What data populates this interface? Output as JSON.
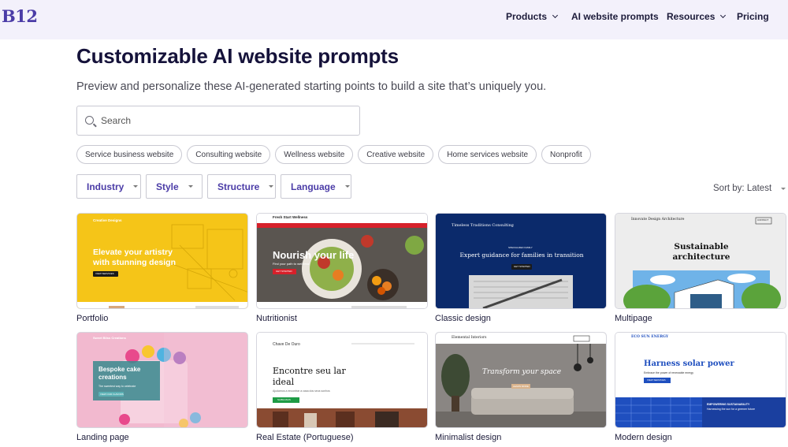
{
  "logo": "B12",
  "nav": {
    "products": "Products",
    "ai_prompts": "AI website prompts",
    "resources": "Resources",
    "pricing": "Pricing"
  },
  "page": {
    "title": "Customizable AI website prompts",
    "subtitle": "Preview and personalize these AI-generated starting points to build a site that’s uniquely you."
  },
  "search": {
    "placeholder": "Search"
  },
  "chips": [
    "Service business website",
    "Consulting website",
    "Wellness website",
    "Creative website",
    "Home services website",
    "Nonprofit"
  ],
  "filters": {
    "industry": "Industry",
    "style": "Style",
    "structure": "Structure",
    "language": "Language"
  },
  "sort": "Sort by: Latest",
  "cards": [
    {
      "label": "Portfolio",
      "thumb": {
        "brand": "Creative Designs",
        "headline": "Elevate your artistry with stunning design",
        "cta": "VIEW SERVICES"
      }
    },
    {
      "label": "Nutritionist",
      "thumb": {
        "brand": "Fresh Start Wellness",
        "headline": "Nourish your life",
        "sub": "Find your path to wellness",
        "cta": "GET STARTED"
      }
    },
    {
      "label": "Classic design",
      "thumb": {
        "brand": "Timeless Traditions Consulting",
        "kicker": "SPECIALIZED FAMILY",
        "headline": "Expert guidance for families in transition",
        "cta": "GET STARTED"
      }
    },
    {
      "label": "Multipage",
      "thumb": {
        "brand": "Innovate Design Architecture",
        "headline": "Sustainable architecture",
        "cta": "CONTACT"
      }
    },
    {
      "label": "Landing page",
      "thumb": {
        "brand": "Sweet Bliss Creations",
        "headline": "Bespoke cake creations",
        "sub": "The sweetest way to celebrate",
        "cta": "VIEW OUR FLAVORS"
      }
    },
    {
      "label": "Real Estate (Portuguese)",
      "thumb": {
        "brand": "Chave De Ouro",
        "headline": "Encontre seu lar ideal",
        "sub": "Ajudamos a encontrar a casa dos seus sonhos",
        "cta": "SAIBA MAIS"
      }
    },
    {
      "label": "Minimalist design",
      "thumb": {
        "brand": "Elemental Interiors",
        "headline": "Transform your space",
        "cta": "LEARN MORE"
      }
    },
    {
      "label": "Modern design",
      "thumb": {
        "brand": "ECO SUN ENERGY",
        "headline": "Harness solar power",
        "sub": "Embrace the power of renewable energy",
        "cta": "VIEW SERVICES",
        "band": "EMPOWERING SUSTAINABILITY",
        "band_sub": "Harnessing the sun for a greener future"
      }
    }
  ],
  "colors": {
    "brand": "#4b3ca7",
    "nav_bg": "#f3f1fb",
    "portfolio_yellow": "#f5c518",
    "classic_navy": "#0b2a6b",
    "modern_blue": "#1f4fbf"
  }
}
